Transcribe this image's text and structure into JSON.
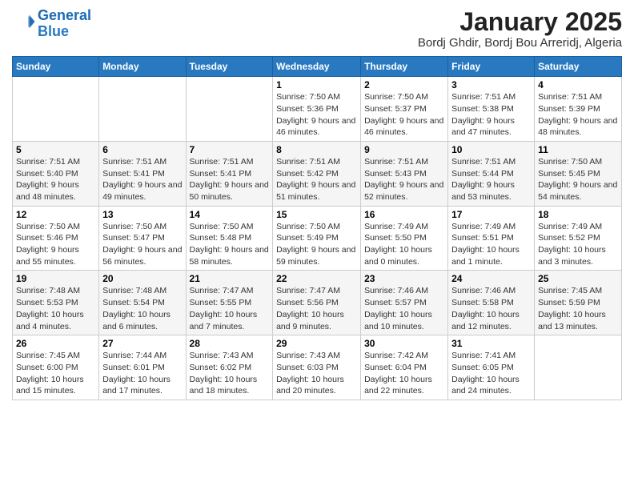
{
  "logo": {
    "line1": "General",
    "line2": "Blue"
  },
  "title": "January 2025",
  "subtitle": "Bordj Ghdir, Bordj Bou Arreridj, Algeria",
  "days_of_week": [
    "Sunday",
    "Monday",
    "Tuesday",
    "Wednesday",
    "Thursday",
    "Friday",
    "Saturday"
  ],
  "weeks": [
    [
      {
        "day": "",
        "info": ""
      },
      {
        "day": "",
        "info": ""
      },
      {
        "day": "",
        "info": ""
      },
      {
        "day": "1",
        "info": "Sunrise: 7:50 AM\nSunset: 5:36 PM\nDaylight: 9 hours and 46 minutes."
      },
      {
        "day": "2",
        "info": "Sunrise: 7:50 AM\nSunset: 5:37 PM\nDaylight: 9 hours and 46 minutes."
      },
      {
        "day": "3",
        "info": "Sunrise: 7:51 AM\nSunset: 5:38 PM\nDaylight: 9 hours and 47 minutes."
      },
      {
        "day": "4",
        "info": "Sunrise: 7:51 AM\nSunset: 5:39 PM\nDaylight: 9 hours and 48 minutes."
      }
    ],
    [
      {
        "day": "5",
        "info": "Sunrise: 7:51 AM\nSunset: 5:40 PM\nDaylight: 9 hours and 48 minutes."
      },
      {
        "day": "6",
        "info": "Sunrise: 7:51 AM\nSunset: 5:41 PM\nDaylight: 9 hours and 49 minutes."
      },
      {
        "day": "7",
        "info": "Sunrise: 7:51 AM\nSunset: 5:41 PM\nDaylight: 9 hours and 50 minutes."
      },
      {
        "day": "8",
        "info": "Sunrise: 7:51 AM\nSunset: 5:42 PM\nDaylight: 9 hours and 51 minutes."
      },
      {
        "day": "9",
        "info": "Sunrise: 7:51 AM\nSunset: 5:43 PM\nDaylight: 9 hours and 52 minutes."
      },
      {
        "day": "10",
        "info": "Sunrise: 7:51 AM\nSunset: 5:44 PM\nDaylight: 9 hours and 53 minutes."
      },
      {
        "day": "11",
        "info": "Sunrise: 7:50 AM\nSunset: 5:45 PM\nDaylight: 9 hours and 54 minutes."
      }
    ],
    [
      {
        "day": "12",
        "info": "Sunrise: 7:50 AM\nSunset: 5:46 PM\nDaylight: 9 hours and 55 minutes."
      },
      {
        "day": "13",
        "info": "Sunrise: 7:50 AM\nSunset: 5:47 PM\nDaylight: 9 hours and 56 minutes."
      },
      {
        "day": "14",
        "info": "Sunrise: 7:50 AM\nSunset: 5:48 PM\nDaylight: 9 hours and 58 minutes."
      },
      {
        "day": "15",
        "info": "Sunrise: 7:50 AM\nSunset: 5:49 PM\nDaylight: 9 hours and 59 minutes."
      },
      {
        "day": "16",
        "info": "Sunrise: 7:49 AM\nSunset: 5:50 PM\nDaylight: 10 hours and 0 minutes."
      },
      {
        "day": "17",
        "info": "Sunrise: 7:49 AM\nSunset: 5:51 PM\nDaylight: 10 hours and 1 minute."
      },
      {
        "day": "18",
        "info": "Sunrise: 7:49 AM\nSunset: 5:52 PM\nDaylight: 10 hours and 3 minutes."
      }
    ],
    [
      {
        "day": "19",
        "info": "Sunrise: 7:48 AM\nSunset: 5:53 PM\nDaylight: 10 hours and 4 minutes."
      },
      {
        "day": "20",
        "info": "Sunrise: 7:48 AM\nSunset: 5:54 PM\nDaylight: 10 hours and 6 minutes."
      },
      {
        "day": "21",
        "info": "Sunrise: 7:47 AM\nSunset: 5:55 PM\nDaylight: 10 hours and 7 minutes."
      },
      {
        "day": "22",
        "info": "Sunrise: 7:47 AM\nSunset: 5:56 PM\nDaylight: 10 hours and 9 minutes."
      },
      {
        "day": "23",
        "info": "Sunrise: 7:46 AM\nSunset: 5:57 PM\nDaylight: 10 hours and 10 minutes."
      },
      {
        "day": "24",
        "info": "Sunrise: 7:46 AM\nSunset: 5:58 PM\nDaylight: 10 hours and 12 minutes."
      },
      {
        "day": "25",
        "info": "Sunrise: 7:45 AM\nSunset: 5:59 PM\nDaylight: 10 hours and 13 minutes."
      }
    ],
    [
      {
        "day": "26",
        "info": "Sunrise: 7:45 AM\nSunset: 6:00 PM\nDaylight: 10 hours and 15 minutes."
      },
      {
        "day": "27",
        "info": "Sunrise: 7:44 AM\nSunset: 6:01 PM\nDaylight: 10 hours and 17 minutes."
      },
      {
        "day": "28",
        "info": "Sunrise: 7:43 AM\nSunset: 6:02 PM\nDaylight: 10 hours and 18 minutes."
      },
      {
        "day": "29",
        "info": "Sunrise: 7:43 AM\nSunset: 6:03 PM\nDaylight: 10 hours and 20 minutes."
      },
      {
        "day": "30",
        "info": "Sunrise: 7:42 AM\nSunset: 6:04 PM\nDaylight: 10 hours and 22 minutes."
      },
      {
        "day": "31",
        "info": "Sunrise: 7:41 AM\nSunset: 6:05 PM\nDaylight: 10 hours and 24 minutes."
      },
      {
        "day": "",
        "info": ""
      }
    ]
  ]
}
